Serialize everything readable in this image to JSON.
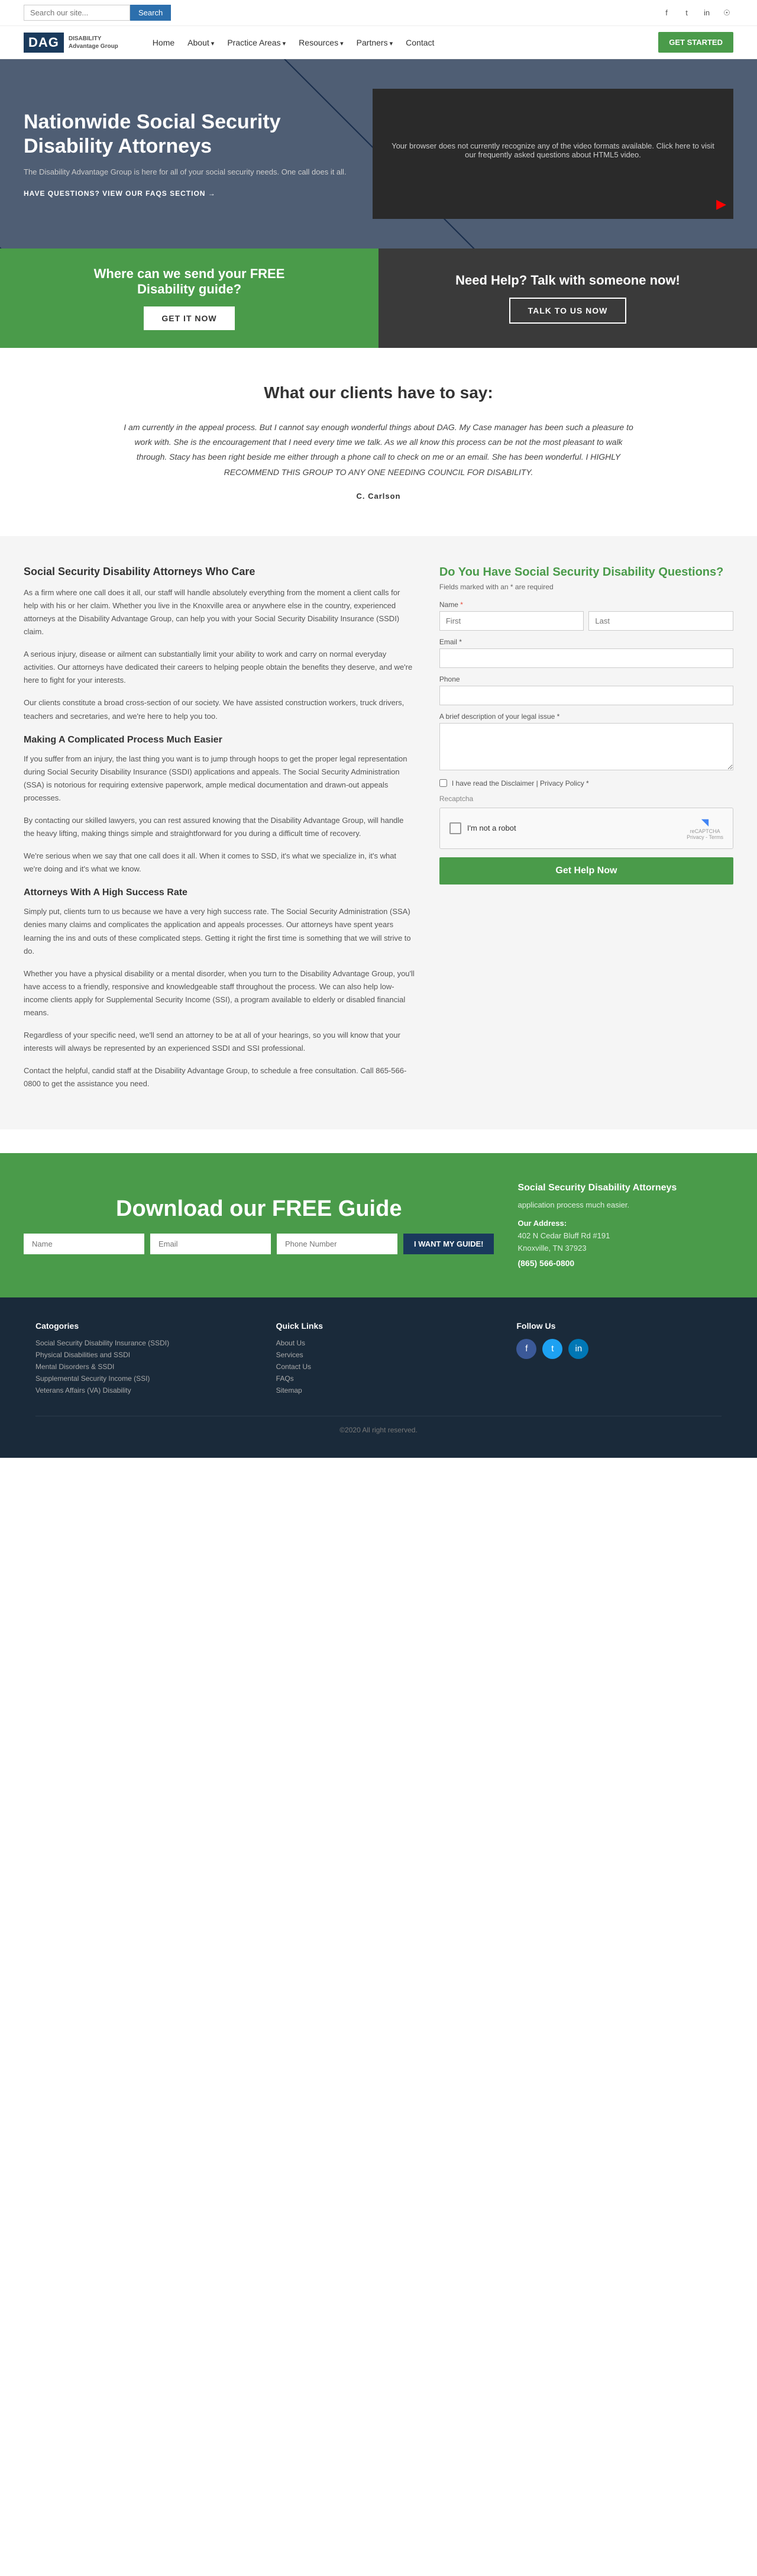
{
  "topbar": {
    "search_placeholder": "Search our site...",
    "search_btn": "Search"
  },
  "nav": {
    "logo_text": "DAG",
    "logo_sub1": "DISABILITY",
    "logo_sub2": "Advantage Group",
    "items": [
      {
        "label": "Home",
        "has_arrow": false
      },
      {
        "label": "About",
        "has_arrow": true
      },
      {
        "label": "Practice Areas",
        "has_arrow": true
      },
      {
        "label": "Resources",
        "has_arrow": true
      },
      {
        "label": "Partners",
        "has_arrow": true
      },
      {
        "label": "Contact",
        "has_arrow": false
      }
    ],
    "cta_btn": "GET STARTED"
  },
  "hero": {
    "title": "Nationwide Social Security Disability Attorneys",
    "desc": "The Disability Advantage Group is here for all of your social security needs. One call does it all.",
    "faq_link": "HAVE QUESTIONS? VIEW OUR FAQS SECTION →",
    "video_text": "Your browser does not currently recognize any of the video formats available. Click here to visit our frequently asked questions about HTML5 video."
  },
  "cta": {
    "left_text_1": "Where can we send your",
    "left_text_2": "FREE",
    "left_text_3": "Disability guide?",
    "left_btn": "GET IT NOW",
    "right_text_1": "Need Help?",
    "right_text_2": "Talk with someone now!",
    "right_btn": "TALK TO US NOW"
  },
  "testimonial": {
    "title": "What our clients have to say:",
    "text": "I am currently in the appeal process. But I cannot say enough wonderful things about DAG. My Case manager has been such a pleasure to work with. She is the encouragement that I need every time we talk. As we all know this process can be not the most pleasant to walk through. Stacy has been right beside me either through a phone call to check on me or an email. She has been wonderful. I HIGHLY RECOMMEND THIS GROUP TO ANY ONE NEEDING COUNCIL FOR DISABILITY.",
    "author": "C. Carlson"
  },
  "content": {
    "section1_title": "Social Security Disability Attorneys Who Care",
    "section1_p1": "As a firm where one call does it all, our staff will handle absolutely everything from the moment a client calls for help with his or her claim. Whether you live in the Knoxville area or anywhere else in the country, experienced attorneys at the Disability Advantage Group, can help you with your Social Security Disability Insurance (SSDI) claim.",
    "section1_p2": "A serious injury, disease or ailment can substantially limit your ability to work and carry on normal everyday activities. Our attorneys have dedicated their careers to helping people obtain the benefits they deserve, and we're here to fight for your interests.",
    "section1_p3": "Our clients constitute a broad cross-section of our society. We have assisted construction workers, truck drivers, teachers and secretaries, and we're here to help you too.",
    "section2_title": "Making A Complicated Process Much Easier",
    "section2_p1": "If you suffer from an injury, the last thing you want is to jump through hoops to get the proper legal representation during Social Security Disability Insurance (SSDI) applications and appeals. The Social Security Administration (SSA) is notorious for requiring extensive paperwork, ample medical documentation and drawn-out appeals processes.",
    "section2_p2": "By contacting our skilled lawyers, you can rest assured knowing that the Disability Advantage Group, will handle the heavy lifting, making things simple and straightforward for you during a difficult time of recovery.",
    "section2_p3": "We're serious when we say that one call does it all. When it comes to SSD, it's what we specialize in, it's what we're doing and it's what we know.",
    "section3_title": "Attorneys With A High Success Rate",
    "section3_p1": "Simply put, clients turn to us because we have a very high success rate. The Social Security Administration (SSA) denies many claims and complicates the application and appeals processes. Our attorneys have spent years learning the ins and outs of these complicated steps. Getting it right the first time is something that we will strive to do.",
    "section3_p2": "Whether you have a physical disability or a mental disorder, when you turn to the Disability Advantage Group, you'll have access to a friendly, responsive and knowledgeable staff throughout the process. We can also help low-income clients apply for Supplemental Security Income (SSI), a program available to elderly or disabled financial means.",
    "section3_p3": "Regardless of your specific need, we'll send an attorney to be at all of your hearings, so you will know that your interests will always be represented by an experienced SSDI and SSI professional.",
    "section3_p4": "Contact the helpful, candid staff at the Disability Advantage Group, to schedule a free consultation. Call 865-566-0800 to get the assistance you need."
  },
  "form": {
    "title": "Do You Have Social Security Disability Questions?",
    "required_note": "Fields marked with an * are required",
    "label_first": "First",
    "label_last": "Last",
    "label_name": "Name",
    "label_email": "Email *",
    "label_phone": "Phone",
    "label_description": "A brief description of your legal issue *",
    "check_label": "I have read the Disclaimer | Privacy Policy *",
    "recaptcha_label": "Recaptcha",
    "robot_label": "I'm not a robot",
    "submit_btn": "Get Help Now"
  },
  "download": {
    "title": "Download our FREE Guide",
    "name_placeholder": "Name",
    "email_placeholder": "Email",
    "phone_placeholder": "Phone Number",
    "cta_btn": "I WANT MY GUIDE!",
    "right_title": "Social Security Disability Attorneys",
    "right_desc": "application process much easier.",
    "address_label": "Our Address:",
    "address_line1": "402 N Cedar Bluff Rd #191",
    "address_line2": "Knoxville, TN 37923",
    "phone": "(865) 566-0800"
  },
  "footer": {
    "categories_title": "Catogories",
    "categories": [
      "Social Security Disability Insurance (SSDI)",
      "Physical Disabilities and SSDI",
      "Mental Disorders & SSDI",
      "Supplemental Security Income (SSI)",
      "Veterans Affairs (VA) Disability"
    ],
    "quicklinks_title": "Quick Links",
    "quicklinks": [
      "About Us",
      "Services",
      "Contact Us",
      "FAQs",
      "Sitemap"
    ],
    "follow_title": "Follow Us",
    "copyright": "©2020 All right reserved."
  }
}
